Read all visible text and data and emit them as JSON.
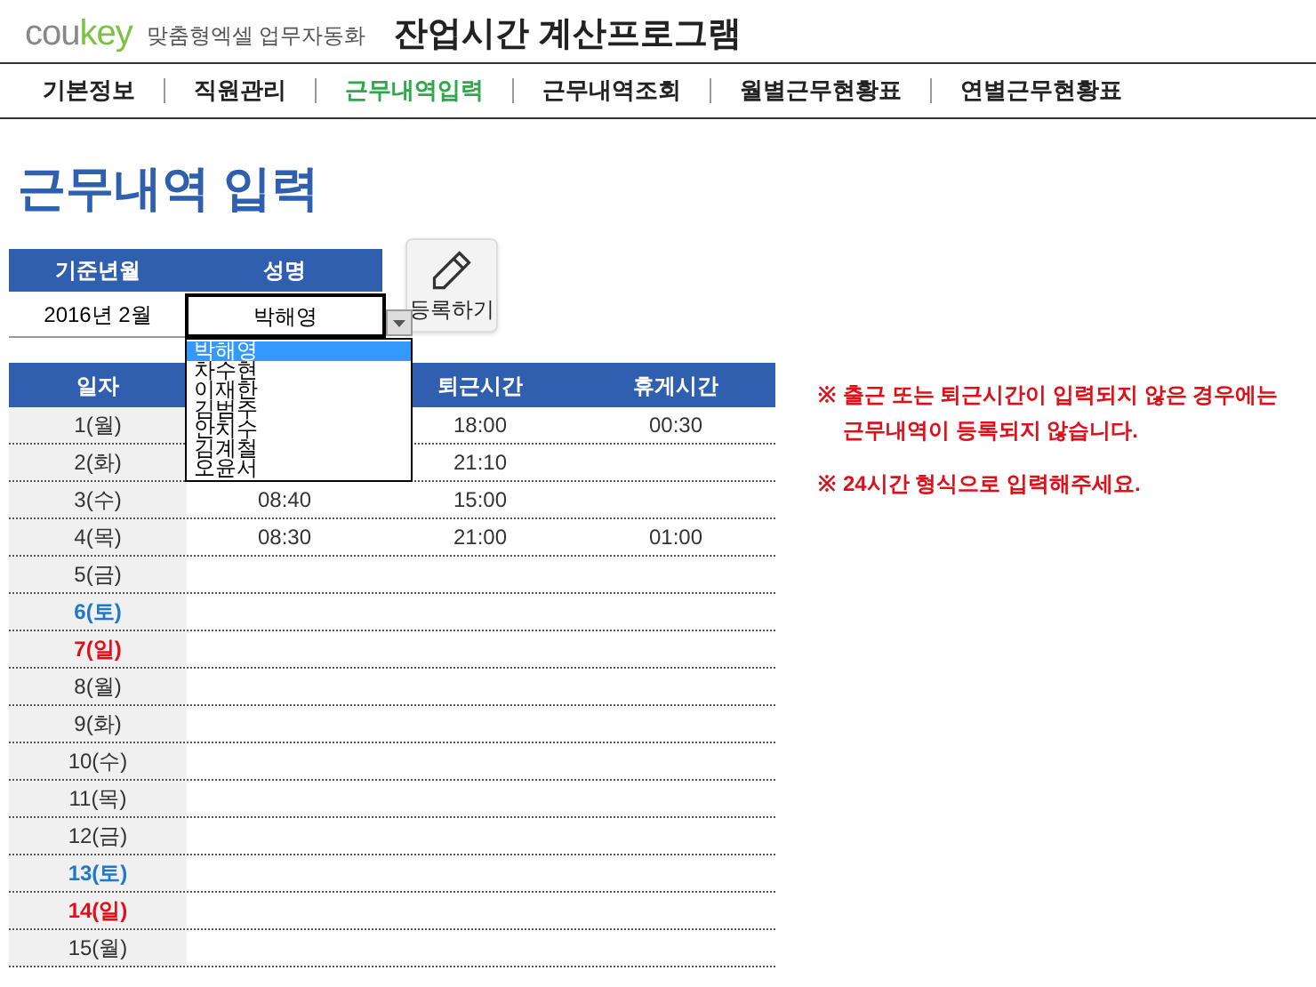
{
  "header": {
    "logo": "coukey",
    "tagline": "맞춤형엑셀 업무자동화",
    "title": "잔업시간 계산프로그램"
  },
  "nav": [
    {
      "label": "기본정보",
      "selected": false
    },
    {
      "label": "직원관리",
      "selected": false
    },
    {
      "label": "근무내역입력",
      "selected": true
    },
    {
      "label": "근무내역조회",
      "selected": false
    },
    {
      "label": "월별근무현황표",
      "selected": false
    },
    {
      "label": "연별근무현황표",
      "selected": false
    }
  ],
  "page_title": "근무내역 입력",
  "filter": {
    "month_label": "기준년월",
    "name_label": "성명",
    "month_value": "2016년 2월",
    "name_value": "박해영"
  },
  "register_button": "등록하기",
  "dropdown": [
    {
      "label": "박해영",
      "selected": true
    },
    {
      "label": "차수현",
      "selected": false
    },
    {
      "label": "이재한",
      "selected": false
    },
    {
      "label": "김범주",
      "selected": false
    },
    {
      "label": "안치수",
      "selected": false
    },
    {
      "label": "김계철",
      "selected": false
    },
    {
      "label": "오윤서",
      "selected": false
    }
  ],
  "table": {
    "columns": [
      "일자",
      null,
      "퇴근시간",
      "휴게시간"
    ],
    "rows": [
      {
        "kind": "weekday",
        "cells": [
          "1(월)",
          null,
          "18:00",
          "00:30"
        ]
      },
      {
        "kind": "weekday",
        "cells": [
          "2(화)",
          null,
          "21:10",
          ""
        ]
      },
      {
        "kind": "weekday",
        "cells": [
          "3(수)",
          "08:40",
          "15:00",
          ""
        ]
      },
      {
        "kind": "weekday",
        "cells": [
          "4(목)",
          "08:30",
          "21:00",
          "01:00"
        ]
      },
      {
        "kind": "weekday",
        "cells": [
          "5(금)",
          "",
          "",
          ""
        ]
      },
      {
        "kind": "saturday",
        "cells": [
          "6(토)",
          "",
          "",
          ""
        ]
      },
      {
        "kind": "sunday",
        "cells": [
          "7(일)",
          "",
          "",
          ""
        ]
      },
      {
        "kind": "weekday",
        "cells": [
          "8(월)",
          "",
          "",
          ""
        ]
      },
      {
        "kind": "weekday",
        "cells": [
          "9(화)",
          "",
          "",
          ""
        ]
      },
      {
        "kind": "weekday",
        "cells": [
          "10(수)",
          "",
          "",
          ""
        ]
      },
      {
        "kind": "weekday",
        "cells": [
          "11(목)",
          "",
          "",
          ""
        ]
      },
      {
        "kind": "weekday",
        "cells": [
          "12(금)",
          "",
          "",
          ""
        ]
      },
      {
        "kind": "saturday",
        "cells": [
          "13(토)",
          "",
          "",
          ""
        ]
      },
      {
        "kind": "sunday",
        "cells": [
          "14(일)",
          "",
          "",
          ""
        ]
      },
      {
        "kind": "weekday",
        "cells": [
          "15(월)",
          "",
          "",
          ""
        ]
      }
    ]
  },
  "notes": [
    {
      "mark": "※",
      "text": "출근 또는 퇴근시간이 입력되지 않은 경우에는 근무내역이 등록되지 않습니다."
    },
    {
      "mark": "※",
      "text": "24시간 형식으로 입력해주세요."
    }
  ]
}
